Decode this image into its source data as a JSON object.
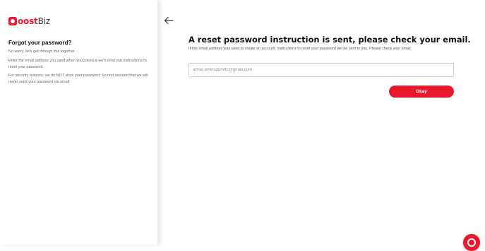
{
  "brand": {
    "logo_text_bold": "oost",
    "logo_text_light": "Biz",
    "accent_color": "#e8192c"
  },
  "sidebar": {
    "title": "Forgot your password?",
    "paragraph_1": "No worry, let's get through this together.",
    "paragraph_2": "Enter the email address you used when you joined & we'll send you instructions to reset your password.",
    "paragraph_3": "For security reasons, we do NOT store your password. So rest assured that we will never send your password via email."
  },
  "main": {
    "back_icon": "arrow-left-icon",
    "title": "A reset password instruction is sent, please check your email.",
    "subtitle": "If this email address was used to create an account, instructions to reset your password will be sent to you. Please check your email.",
    "email_value": "azhar.aminuddin95@gmail.com",
    "okay_label": "Okay"
  },
  "help": {
    "icon": "help-chat-icon"
  }
}
